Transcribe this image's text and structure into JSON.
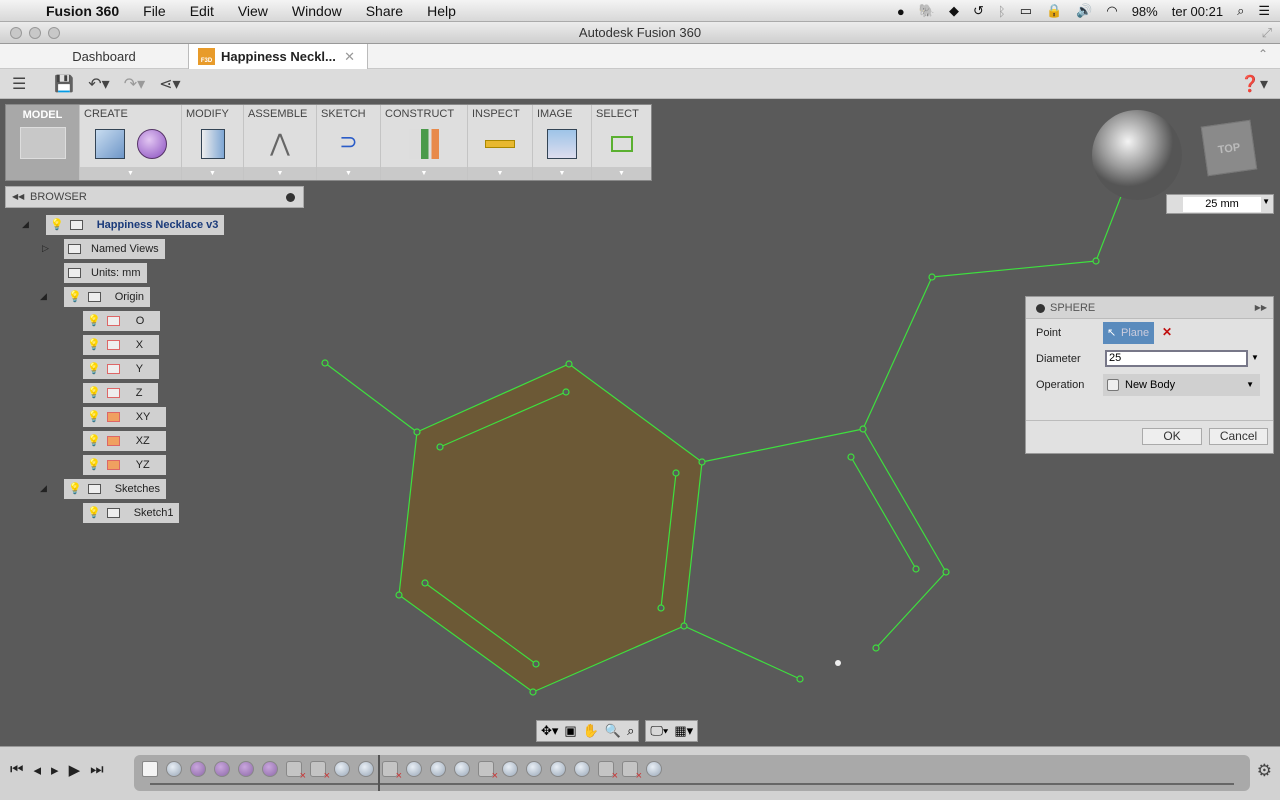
{
  "menubar": {
    "app": "Fusion 360",
    "items": [
      "File",
      "Edit",
      "View",
      "Window",
      "Share",
      "Help"
    ],
    "battery": "98%",
    "clock": "ter 00:21"
  },
  "window": {
    "title": "Autodesk Fusion 360"
  },
  "tabs": [
    {
      "label": "Dashboard"
    },
    {
      "label": "Happiness Neckl...",
      "icon": "F3D"
    }
  ],
  "ribbon": {
    "workspace": "MODEL",
    "groups": [
      "CREATE",
      "MODIFY",
      "ASSEMBLE",
      "SKETCH",
      "CONSTRUCT",
      "INSPECT",
      "IMAGE",
      "SELECT"
    ]
  },
  "browser": {
    "title": "BROWSER",
    "root": "Happiness Necklace v3",
    "named_views": "Named Views",
    "units": "Units: mm",
    "origin": "Origin",
    "origin_items": [
      "O",
      "X",
      "Y",
      "Z",
      "XY",
      "XZ",
      "YZ"
    ],
    "sketches": "Sketches",
    "sketch1": "Sketch1"
  },
  "viewcube": {
    "face": "TOP",
    "scale": "25 mm"
  },
  "dialog": {
    "title": "SPHERE",
    "point_label": "Point",
    "point_value": "Plane",
    "diameter_label": "Diameter",
    "diameter_value": "25",
    "operation_label": "Operation",
    "operation_value": "New Body",
    "ok": "OK",
    "cancel": "Cancel"
  },
  "colors": {
    "sketch_line": "#3ee03e",
    "profile_fill": "#6e5a35",
    "viewport": "#5a5a5a"
  },
  "timeline": {
    "items": [
      "sketch",
      "sphere",
      "purple",
      "purple",
      "purple",
      "purple",
      "body-removed",
      "body-removed",
      "sphere",
      "sphere",
      "body-removed",
      "sphere",
      "sphere",
      "sphere",
      "body-removed",
      "sphere",
      "sphere",
      "sphere",
      "sphere",
      "body-removed",
      "body-removed",
      "sphere"
    ]
  }
}
